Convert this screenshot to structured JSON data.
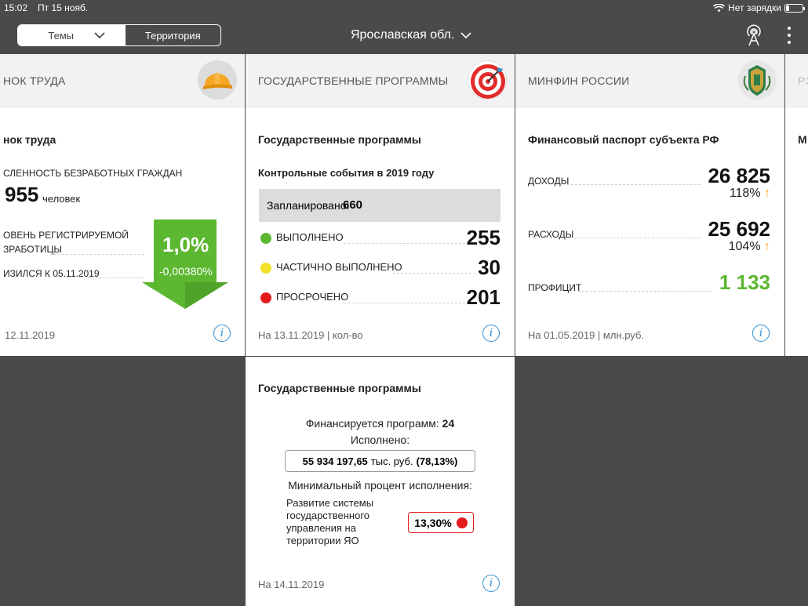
{
  "status": {
    "time": "15:02",
    "date": "Пт 15 нояб.",
    "charging": "Нет зарядки"
  },
  "nav": {
    "tab_topics": "Темы",
    "tab_territory": "Территория",
    "region": "Ярославская обл."
  },
  "cards": {
    "labor": {
      "header": "НОК ТРУДА",
      "title": "нок труда",
      "row1_label": "СЛЕННОСТЬ БЕЗРАБОТНЫХ ГРАЖДАН",
      "row1_value": "955",
      "row1_unit": "человек",
      "row2_label_a": "ОВЕНЬ РЕГИСТРИРУЕМОЙ",
      "row2_label_b": "ЗРАБОТИЦЫ",
      "row3_label": "ИЗИЛСЯ К 05.11.2019",
      "arrow_value": "1,0%",
      "arrow_delta": "-0,00380%",
      "footer": "12.11.2019"
    },
    "programs": {
      "header": "ГОСУДАРСТВЕННЫЕ ПРОГРАММЫ",
      "title": "Государственные программы",
      "subtitle": "Контрольные события в 2019 году",
      "planned_label": "Запланировано:",
      "planned_value": "660",
      "done_label": "ВЫПОЛНЕНО",
      "done_value": "255",
      "partial_label": "ЧАСТИЧНО ВЫПОЛНЕНО",
      "partial_value": "30",
      "overdue_label": "ПРОСРОЧЕНО",
      "overdue_value": "201",
      "footer": "На 13.11.2019 | кол-во"
    },
    "programs2": {
      "title": "Государственные программы",
      "funded_label": "Финансируется программ:",
      "funded_value": "24",
      "executed_label": "Исполнено:",
      "executed_amount": "55 934 197,65",
      "executed_unit": "тыс. руб.",
      "executed_pct": "(78,13%)",
      "min_label": "Минимальный процент исполнения:",
      "min_program": "Развитие системы государственного управления на территории ЯО",
      "min_value": "13,30%",
      "footer": "На 14.11.2019"
    },
    "minfin": {
      "header": "МИНФИН РОССИИ",
      "title": "Финансовый паспорт субъекта РФ",
      "income_label": "ДОХОДЫ",
      "income_value": "26 825",
      "income_pct": "118%",
      "expense_label": "РАСХОДЫ",
      "expense_value": "25 692",
      "expense_pct": "104%",
      "surplus_label": "ПРОФИЦИТ",
      "surplus_value": "1 133",
      "footer": "На 01.05.2019 | млн.руб."
    },
    "partial": {
      "header": "РЭ",
      "title": "М"
    }
  },
  "colors": {
    "green": "#5cb731",
    "yellow": "#f2e12a",
    "red": "#e31b1b",
    "info": "#2f8fd4",
    "orange": "#f2a11a"
  }
}
